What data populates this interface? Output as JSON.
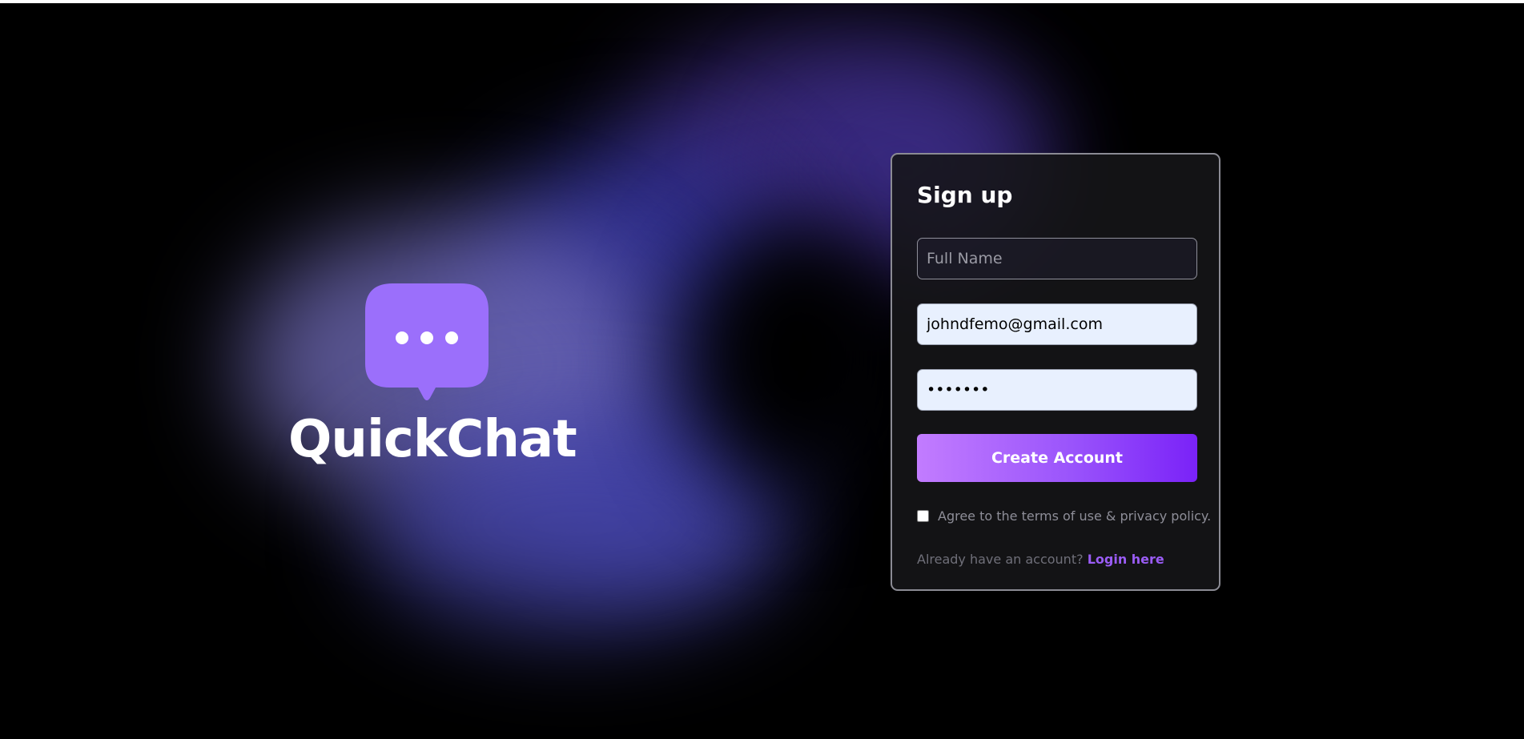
{
  "brand": {
    "name": "QuickChat",
    "icon": "chat-bubble-dots-icon",
    "icon_color": "#9b6ffb"
  },
  "signup": {
    "title": "Sign up",
    "full_name": {
      "placeholder": "Full Name",
      "value": ""
    },
    "email": {
      "placeholder": "",
      "value": "johndfemo@gmail.com"
    },
    "password": {
      "placeholder": "",
      "value": "•••••••"
    },
    "submit_label": "Create Account",
    "terms_label": "Agree to the terms of use & privacy policy.",
    "terms_checked": false,
    "login_prompt": "Already have an account?",
    "login_link": "Login here"
  },
  "colors": {
    "accent": "#9a5cf5",
    "button_gradient_start": "#c27cff",
    "button_gradient_end": "#7a22f8",
    "background": "#000000",
    "card_background": "#161618"
  }
}
